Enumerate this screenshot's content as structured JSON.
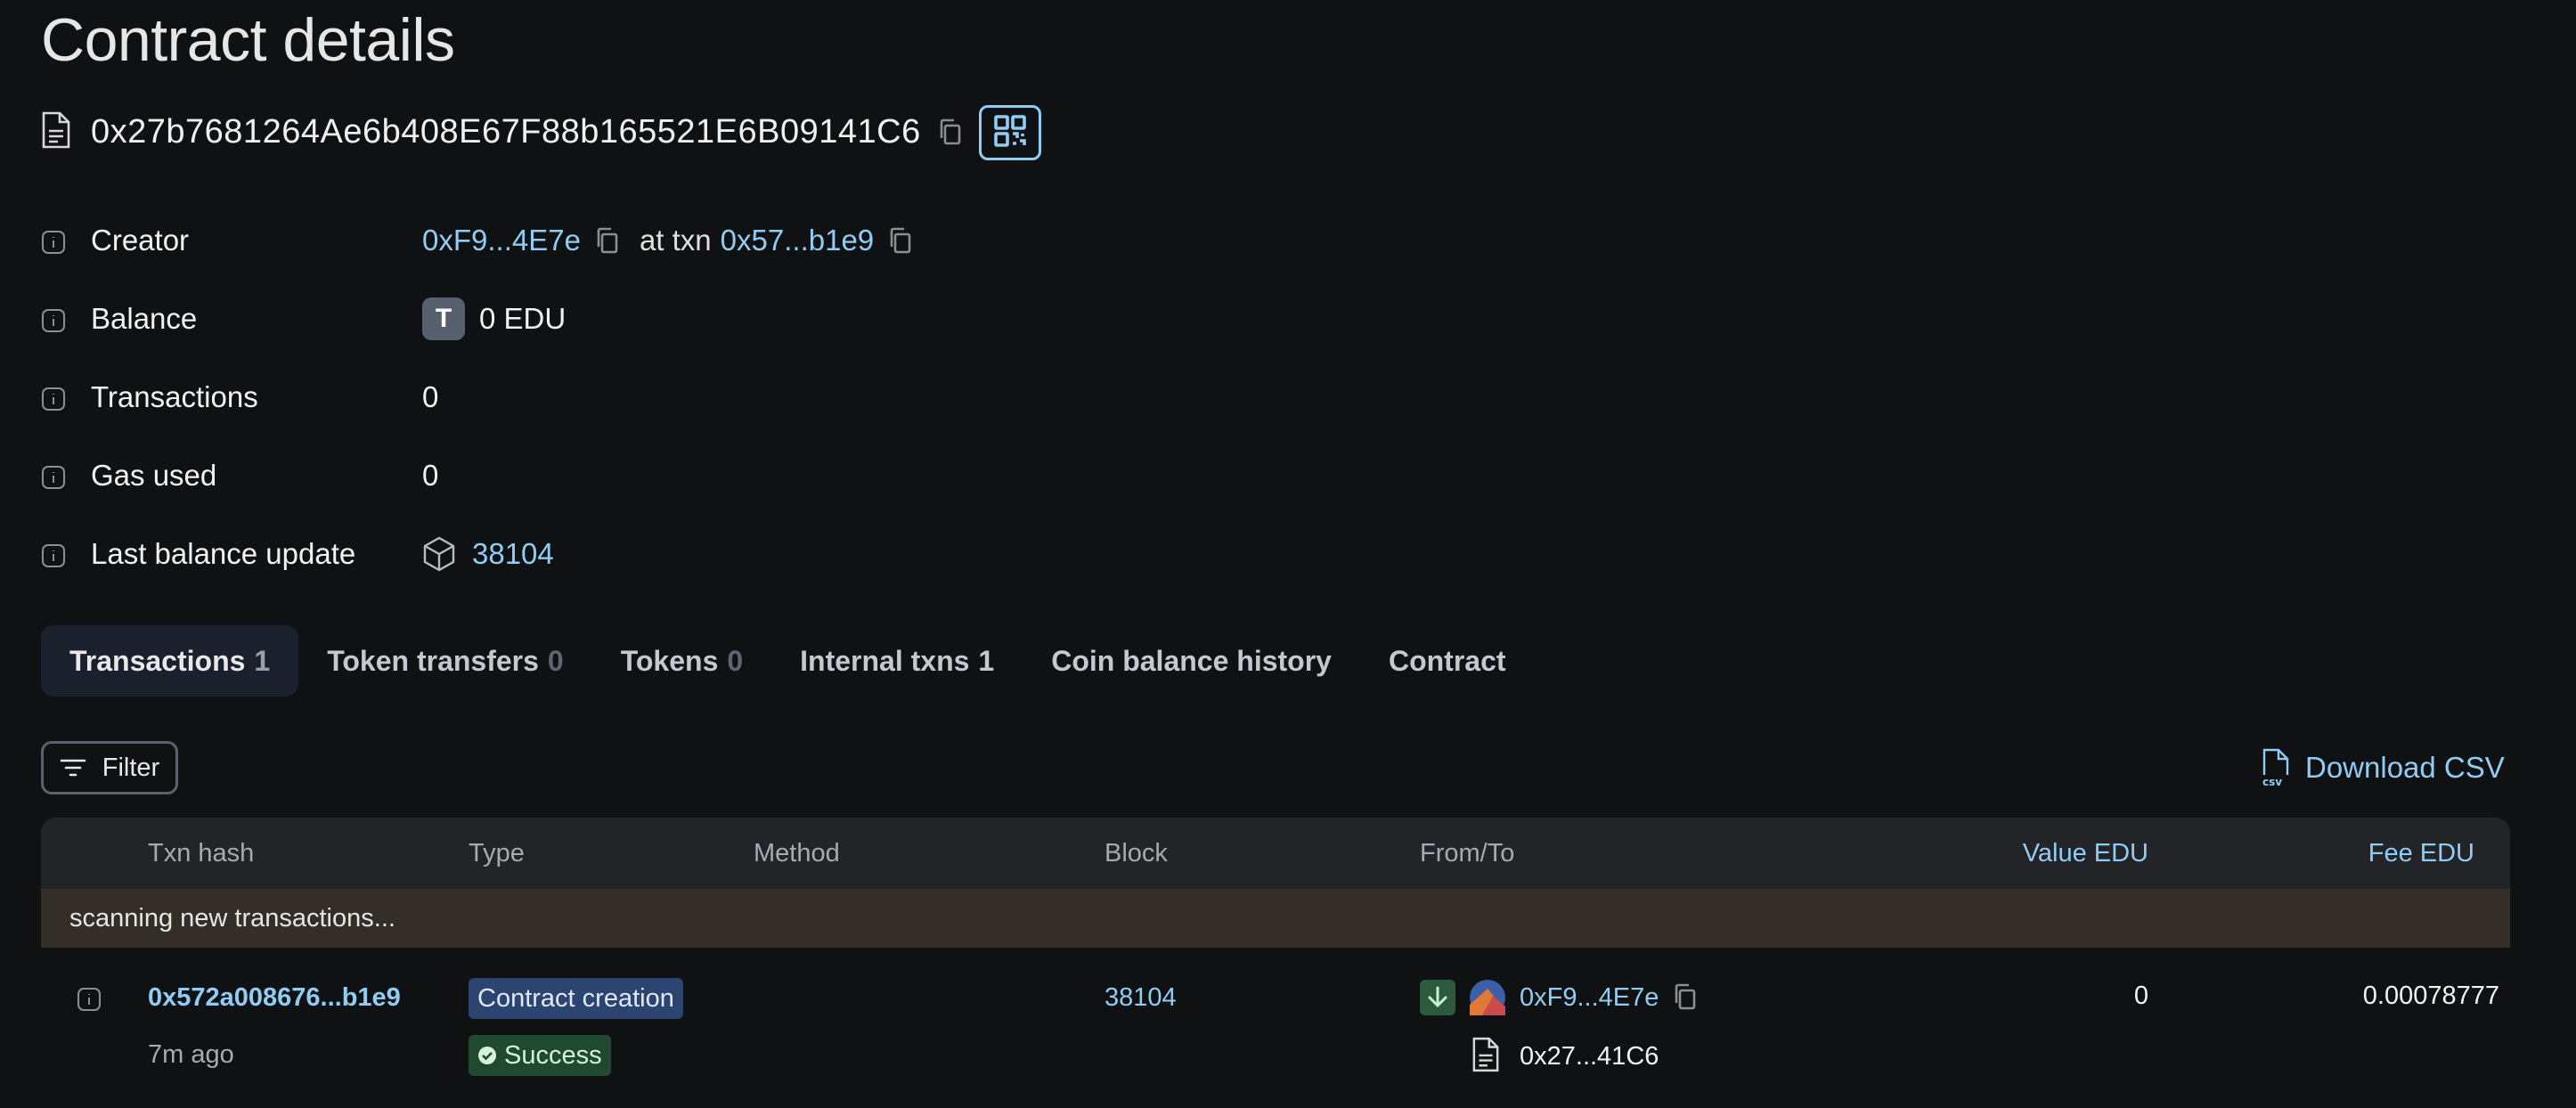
{
  "page": {
    "title": "Contract details"
  },
  "address": {
    "full": "0x27b7681264Ae6b408E67F88b165521E6B09141C6"
  },
  "details": {
    "creator": {
      "label": "Creator",
      "address": "0xF9...4E7e",
      "at_txn_text": "at txn",
      "txn": "0x57...b1e9"
    },
    "balance": {
      "label": "Balance",
      "badge": "T",
      "value": "0 EDU"
    },
    "transactions": {
      "label": "Transactions",
      "value": "0"
    },
    "gas_used": {
      "label": "Gas used",
      "value": "0"
    },
    "last_balance_update": {
      "label": "Last balance update",
      "block": "38104"
    }
  },
  "tabs": [
    {
      "label": "Transactions",
      "count": "1",
      "active": true
    },
    {
      "label": "Token transfers",
      "count": "0"
    },
    {
      "label": "Tokens",
      "count": "0"
    },
    {
      "label": "Internal txns",
      "count": "1"
    },
    {
      "label": "Coin balance history",
      "count": ""
    },
    {
      "label": "Contract",
      "count": ""
    }
  ],
  "toolbar": {
    "filter_label": "Filter",
    "download_label": "Download CSV",
    "csv_icon_text": "csv"
  },
  "table": {
    "headers": {
      "txn_hash": "Txn hash",
      "type": "Type",
      "method": "Method",
      "block": "Block",
      "from_to": "From/To",
      "value": "Value EDU",
      "fee": "Fee EDU"
    },
    "scanning_text": "scanning new transactions...",
    "rows": [
      {
        "hash": "0x572a008676...b1e9",
        "age": "7m ago",
        "type": "Contract creation",
        "status": "Success",
        "method": "",
        "block": "38104",
        "from": "0xF9...4E7e",
        "to": "0x27...41C6",
        "value": "0",
        "fee": "0.00078777"
      }
    ]
  },
  "colors": {
    "link": "#90cdf4",
    "background": "#101112",
    "success": "#1f4a30",
    "type_badge": "#2c4470"
  },
  "icons": [
    "file-icon",
    "copy-icon",
    "qr-code-icon",
    "info-icon",
    "cube-icon",
    "filter-icon",
    "csv-file-icon",
    "arrow-down-icon",
    "identicon",
    "check-circle-icon"
  ]
}
